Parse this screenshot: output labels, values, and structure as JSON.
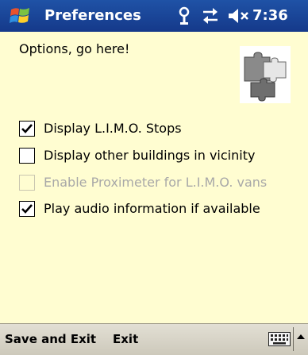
{
  "titlebar": {
    "title": "Preferences",
    "time": "7:36"
  },
  "content": {
    "prompt": "Options, go here!",
    "options": [
      {
        "label": "Display L.I.M.O. Stops",
        "checked": true,
        "enabled": true
      },
      {
        "label": "Display other buildings in vicinity",
        "checked": false,
        "enabled": true
      },
      {
        "label": "Enable Proximeter for L.I.M.O. vans",
        "checked": false,
        "enabled": false
      },
      {
        "label": "Play audio information if available",
        "checked": true,
        "enabled": true
      }
    ]
  },
  "menubar": {
    "save_exit": "Save and Exit",
    "exit": "Exit"
  },
  "icons": {
    "start": "windows-flag-icon",
    "antenna": "antenna-icon",
    "sync": "sync-arrows-icon",
    "volume": "speaker-muted-icon",
    "keyboard": "keyboard-icon",
    "sip_arrow": "caret-up-icon",
    "puzzle": "puzzle-pieces-icon"
  },
  "colors": {
    "titlebar": "#1f52a6",
    "background": "#fffdd1",
    "menubar": "#d8d5ca",
    "disabled_text": "#a8a8a8"
  }
}
